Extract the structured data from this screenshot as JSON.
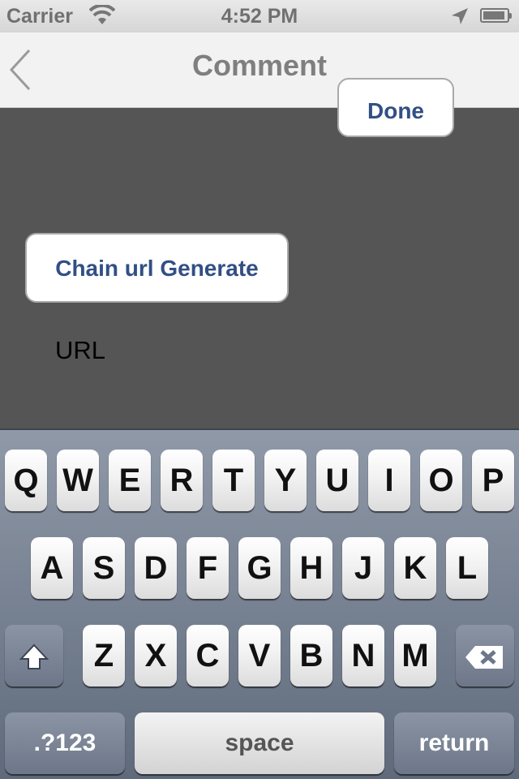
{
  "status_bar": {
    "carrier": "Carrier",
    "time": "4:52 PM"
  },
  "nav": {
    "title": "Comment"
  },
  "content": {
    "done_label": "Done",
    "chain_button_label": "Chain url Generate",
    "url_label": "URL"
  },
  "keyboard": {
    "row1": [
      "Q",
      "W",
      "E",
      "R",
      "T",
      "Y",
      "U",
      "I",
      "O",
      "P"
    ],
    "row2": [
      "A",
      "S",
      "D",
      "F",
      "G",
      "H",
      "J",
      "K",
      "L"
    ],
    "row3": [
      "Z",
      "X",
      "C",
      "V",
      "B",
      "N",
      "M"
    ],
    "numbers_label": ".?123",
    "space_label": "space",
    "return_label": "return"
  }
}
